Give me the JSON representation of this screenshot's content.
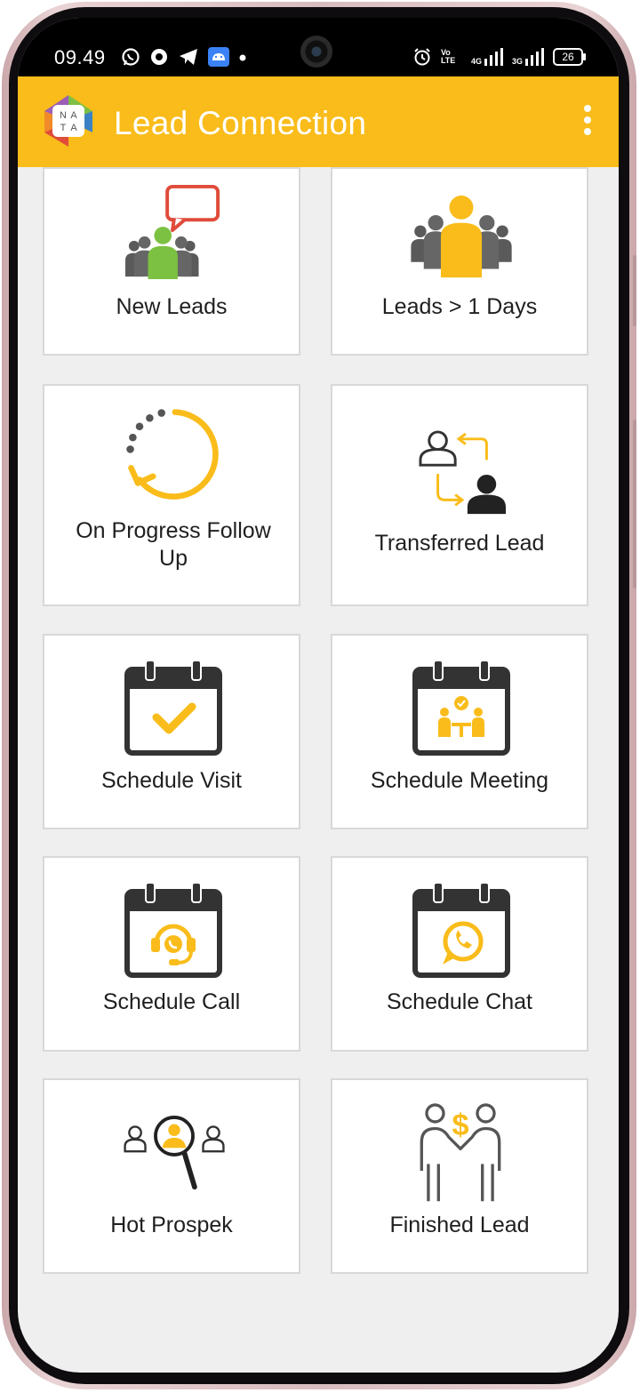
{
  "status_bar": {
    "time": "09.49",
    "network_left": "4G",
    "network_right": "3G",
    "volte": "Vo LTE",
    "battery": "26"
  },
  "app_bar": {
    "title": "Lead Connection",
    "logo_letters": [
      "N",
      "A",
      "T",
      "A"
    ]
  },
  "tiles": [
    {
      "label": "New Leads",
      "icon": "new-leads-icon"
    },
    {
      "label": "Leads > 1 Days",
      "icon": "leads-aged-icon"
    },
    {
      "label": "On Progress Follow Up",
      "icon": "progress-icon"
    },
    {
      "label": "Transferred Lead",
      "icon": "transfer-icon"
    },
    {
      "label": "Schedule Visit",
      "icon": "calendar-check-icon"
    },
    {
      "label": "Schedule Meeting",
      "icon": "calendar-meeting-icon"
    },
    {
      "label": "Schedule Call",
      "icon": "calendar-call-icon"
    },
    {
      "label": "Schedule Chat",
      "icon": "calendar-chat-icon"
    },
    {
      "label": "Hot Prospek",
      "icon": "prospect-search-icon"
    },
    {
      "label": "Finished Lead",
      "icon": "deal-money-icon"
    }
  ],
  "colors": {
    "accent": "#f9bc1a",
    "green": "#7cc142",
    "red": "#e04b3a",
    "dark": "#444444"
  }
}
